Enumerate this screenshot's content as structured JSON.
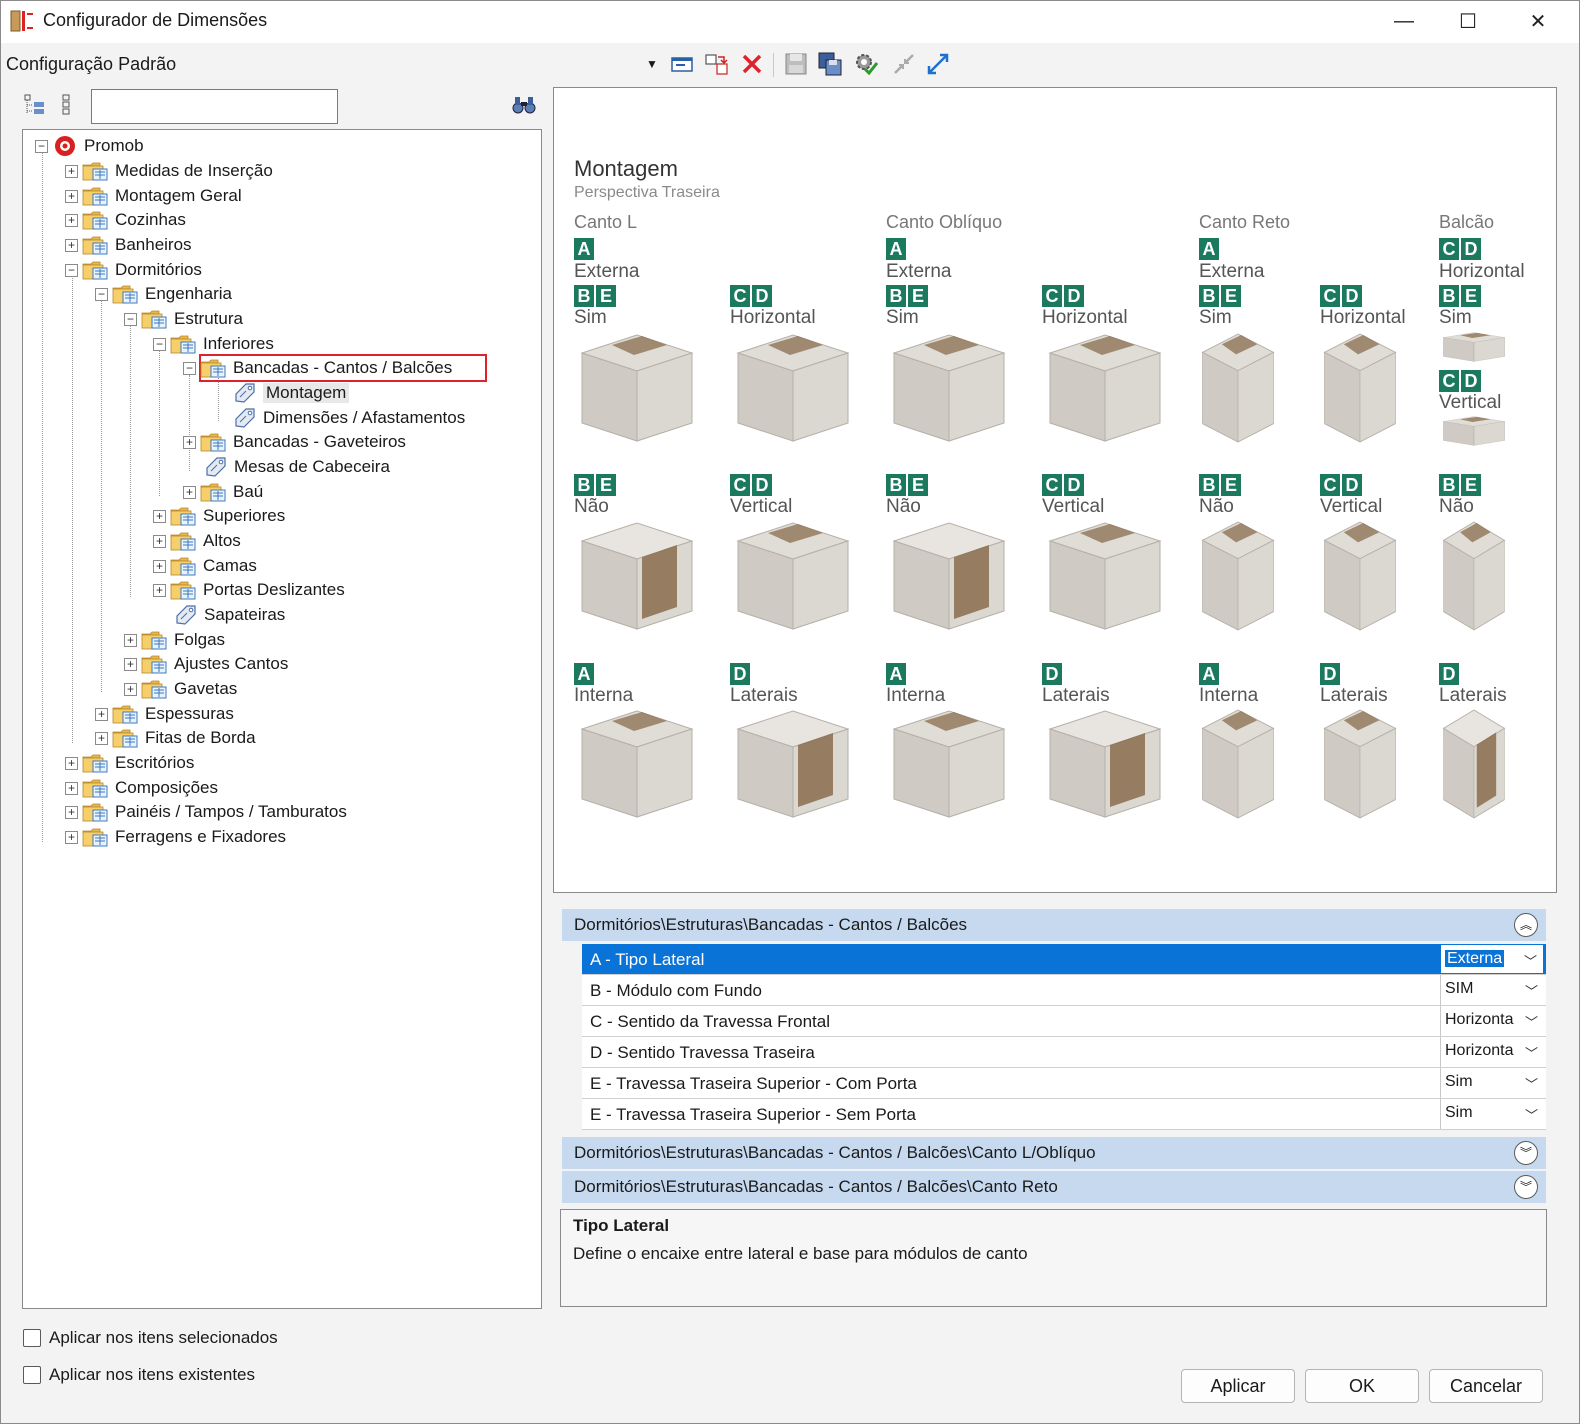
{
  "window": {
    "title": "Configurador de Dimensões",
    "minimize": "—",
    "maximize": "☐",
    "close": "✕"
  },
  "toolbar": {
    "config_name": "Configuração Padrão"
  },
  "tree": {
    "search_value": "",
    "items": [
      {
        "label": "Promob"
      },
      {
        "label": "Medidas de Inserção"
      },
      {
        "label": "Montagem Geral"
      },
      {
        "label": "Cozinhas"
      },
      {
        "label": "Banheiros"
      },
      {
        "label": "Dormitórios"
      },
      {
        "label": "Engenharia"
      },
      {
        "label": "Estrutura"
      },
      {
        "label": "Inferiores"
      },
      {
        "label": "Bancadas - Cantos / Balcões"
      },
      {
        "label": "Montagem"
      },
      {
        "label": "Dimensões / Afastamentos"
      },
      {
        "label": "Bancadas - Gaveteiros"
      },
      {
        "label": "Mesas de Cabeceira"
      },
      {
        "label": "Baú"
      },
      {
        "label": "Superiores"
      },
      {
        "label": "Altos"
      },
      {
        "label": "Camas"
      },
      {
        "label": "Portas Deslizantes"
      },
      {
        "label": "Sapateiras"
      },
      {
        "label": "Folgas"
      },
      {
        "label": "Ajustes Cantos"
      },
      {
        "label": "Gavetas"
      },
      {
        "label": "Espessuras"
      },
      {
        "label": "Fitas de Borda"
      },
      {
        "label": "Escritórios"
      },
      {
        "label": "Composições"
      },
      {
        "label": "Painéis / Tampos / Tamburatos"
      },
      {
        "label": "Ferragens e Fixadores"
      }
    ]
  },
  "checkboxes": {
    "selected_items": "Aplicar nos itens selecionados",
    "existing_items": "Aplicar nos itens existentes"
  },
  "image": {
    "title": "Montagem",
    "subtitle": "Perspectiva Traseira",
    "columns": [
      "Canto L",
      "Canto Oblíquo",
      "Canto Reto",
      "Balcão"
    ],
    "badge_A": "A",
    "badge_B": "B",
    "badge_C": "C",
    "badge_D": "D",
    "badge_E": "E",
    "externa": "Externa",
    "interna": "Interna",
    "sim": "Sim",
    "nao": "Não",
    "horizontal": "Horizontal",
    "vertical": "Vertical",
    "laterais": "Laterais"
  },
  "groups": [
    {
      "label": "Dormitórios\\Estruturas\\Bancadas - Cantos / Balcões"
    },
    {
      "label": "Dormitórios\\Estruturas\\Bancadas - Cantos / Balcões\\Canto L/Oblíquo"
    },
    {
      "label": "Dormitórios\\Estruturas\\Bancadas - Cantos / Balcões\\Canto Reto"
    }
  ],
  "properties": [
    {
      "name": "A - Tipo Lateral",
      "value": "Externa"
    },
    {
      "name": "B - Módulo com Fundo",
      "value": "SIM"
    },
    {
      "name": "C - Sentido da Travessa Frontal",
      "value": "Horizonta"
    },
    {
      "name": "D - Sentido Travessa Traseira",
      "value": "Horizonta"
    },
    {
      "name": "E - Travessa Traseira Superior - Com Porta",
      "value": "Sim"
    },
    {
      "name": "E - Travessa Traseira Superior - Sem Porta",
      "value": "Sim"
    }
  ],
  "description": {
    "title": "Tipo Lateral",
    "text": "Define o encaixe entre lateral e base para módulos de canto"
  },
  "buttons": {
    "apply": "Aplicar",
    "ok": "OK",
    "cancel": "Cancelar"
  },
  "colors": {
    "badge": "#1b7a5e",
    "selection": "#0a73d8",
    "group_header": "#c7d9ef",
    "highlight_border": "#e0202a"
  }
}
